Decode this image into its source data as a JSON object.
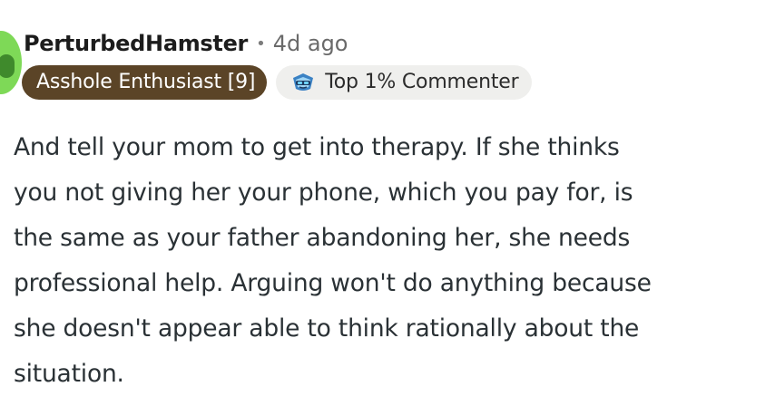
{
  "comment": {
    "author": "PerturbedHamster",
    "separator": "•",
    "timestamp": "4d ago",
    "flair": "Asshole Enthusiast [9]",
    "achievement": {
      "label": "Top 1% Commenter",
      "icon": "top-commenter-badge-icon"
    },
    "body_lines": [
      "And tell your mom to get into therapy. If she thinks",
      "you not giving her your phone, which you pay for, is",
      "the same as your father abandoning her, she needs",
      "professional help. Arguing won't do anything because",
      "she doesn't appear able to think rationally about the",
      "situation."
    ]
  },
  "colors": {
    "avatar_bg": "#7ed957",
    "flair_bg": "#5b4427",
    "achievement_bg": "#efefed",
    "body_text": "#2a3135"
  }
}
